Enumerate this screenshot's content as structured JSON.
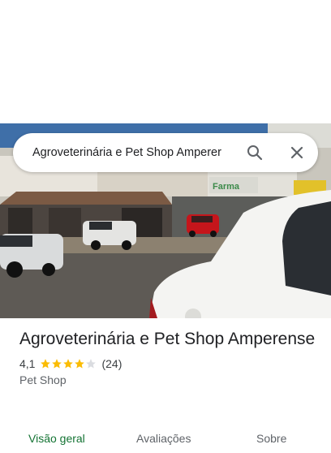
{
  "search": {
    "query": "Agroveterinária e Pet Shop Amperer"
  },
  "place": {
    "name": "Agroveterinária e Pet Shop Amperense",
    "rating": "4,1",
    "stars": 4.1,
    "review_count": "(24)",
    "category": "Pet Shop"
  },
  "tabs": [
    {
      "label": "Visão geral",
      "active": true
    },
    {
      "label": "Avaliações",
      "active": false
    },
    {
      "label": "Sobre",
      "active": false
    }
  ],
  "photo": {
    "sign_text": "Farma"
  },
  "colors": {
    "star": "#fbbc04",
    "star_empty": "#dadce0",
    "active_tab": "#137333",
    "title": "#202124"
  },
  "icons": {
    "search": "search-icon",
    "close": "close-icon"
  }
}
